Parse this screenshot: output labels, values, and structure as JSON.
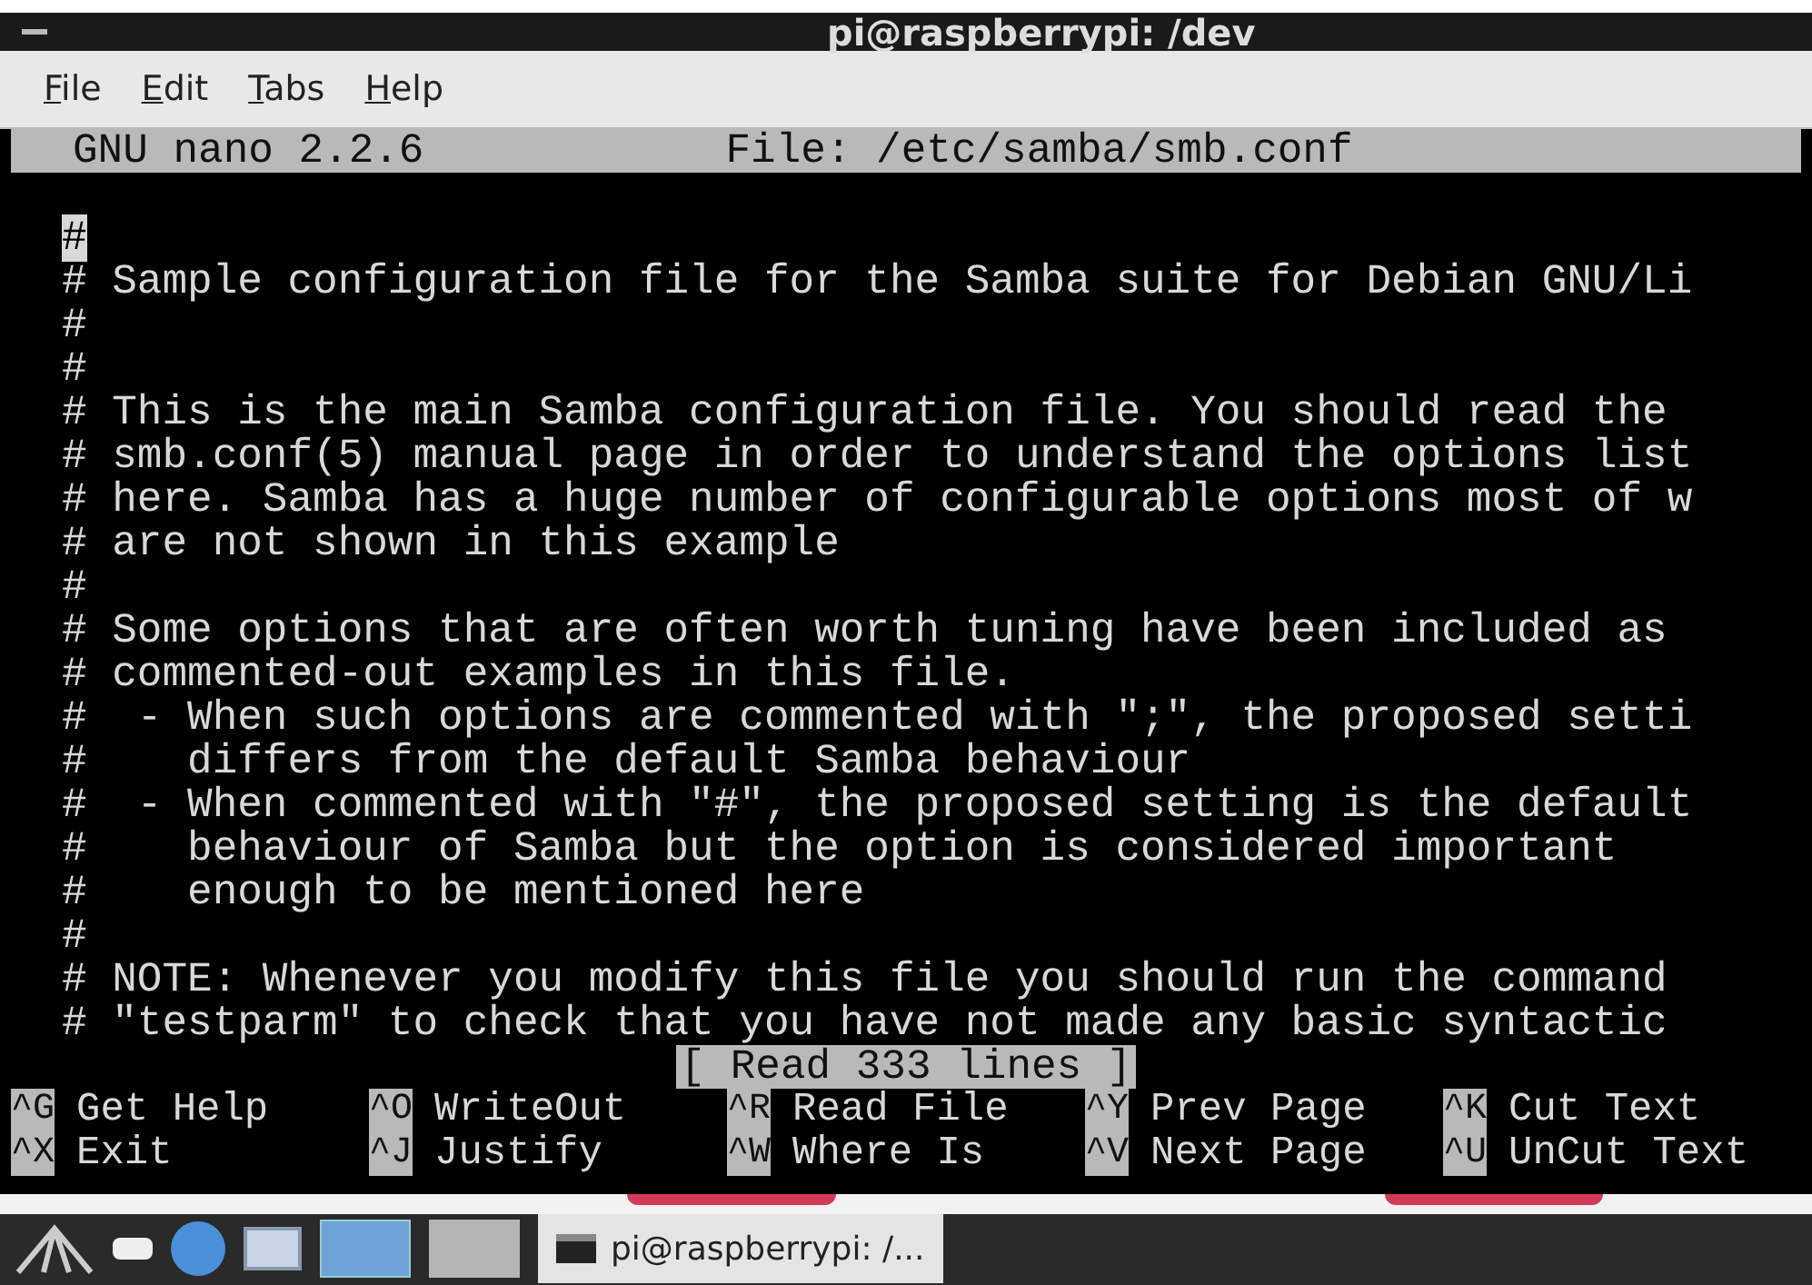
{
  "window": {
    "title": "pi@raspberrypi: /dev"
  },
  "menu": [
    {
      "label": "File"
    },
    {
      "label": "Edit"
    },
    {
      "label": "Tabs"
    },
    {
      "label": "Help"
    }
  ],
  "nano_header": {
    "version": "GNU nano 2.2.6",
    "file": "File: /etc/samba/smb.conf"
  },
  "lines": [
    {
      "text": "#",
      "cursor": true
    },
    {
      "text": "# Sample configuration file for the Samba suite for Debian GNU/Li",
      "cursor": false
    },
    {
      "text": "#",
      "cursor": false
    },
    {
      "text": "#",
      "cursor": false
    },
    {
      "text": "# This is the main Samba configuration file. You should read the",
      "cursor": false
    },
    {
      "text": "# smb.conf(5) manual page in order to understand the options list",
      "cursor": false
    },
    {
      "text": "# here. Samba has a huge number of configurable options most of w",
      "cursor": false
    },
    {
      "text": "# are not shown in this example",
      "cursor": false
    },
    {
      "text": "#",
      "cursor": false
    },
    {
      "text": "# Some options that are often worth tuning have been included as",
      "cursor": false
    },
    {
      "text": "# commented-out examples in this file.",
      "cursor": false
    },
    {
      "text": "#  - When such options are commented with \";\", the proposed setti",
      "cursor": false
    },
    {
      "text": "#    differs from the default Samba behaviour",
      "cursor": false
    },
    {
      "text": "#  - When commented with \"#\", the proposed setting is the default",
      "cursor": false
    },
    {
      "text": "#    behaviour of Samba but the option is considered important",
      "cursor": false
    },
    {
      "text": "#    enough to be mentioned here",
      "cursor": false
    },
    {
      "text": "#",
      "cursor": false
    },
    {
      "text": "# NOTE: Whenever you modify this file you should run the command",
      "cursor": false
    },
    {
      "text": "# \"testparm\" to check that you have not made any basic syntactic",
      "cursor": false
    }
  ],
  "status": "[ Read 333 lines ]",
  "shortcut_rows": [
    [
      {
        "key": "^G",
        "label": "Get Help"
      },
      {
        "key": "^O",
        "label": "WriteOut"
      },
      {
        "key": "^R",
        "label": "Read File"
      },
      {
        "key": "^Y",
        "label": "Prev Page"
      },
      {
        "key": "^K",
        "label": "Cut Text"
      }
    ],
    [
      {
        "key": "^X",
        "label": "Exit"
      },
      {
        "key": "^J",
        "label": "Justify"
      },
      {
        "key": "^W",
        "label": "Where Is"
      },
      {
        "key": "^V",
        "label": "Next Page"
      },
      {
        "key": "^U",
        "label": "UnCut Text"
      }
    ]
  ],
  "taskbar": {
    "workspaces": [
      {
        "selected": true
      },
      {
        "selected": false
      }
    ],
    "tasks": [
      {
        "label": "pi@raspberrypi: /..."
      }
    ]
  }
}
